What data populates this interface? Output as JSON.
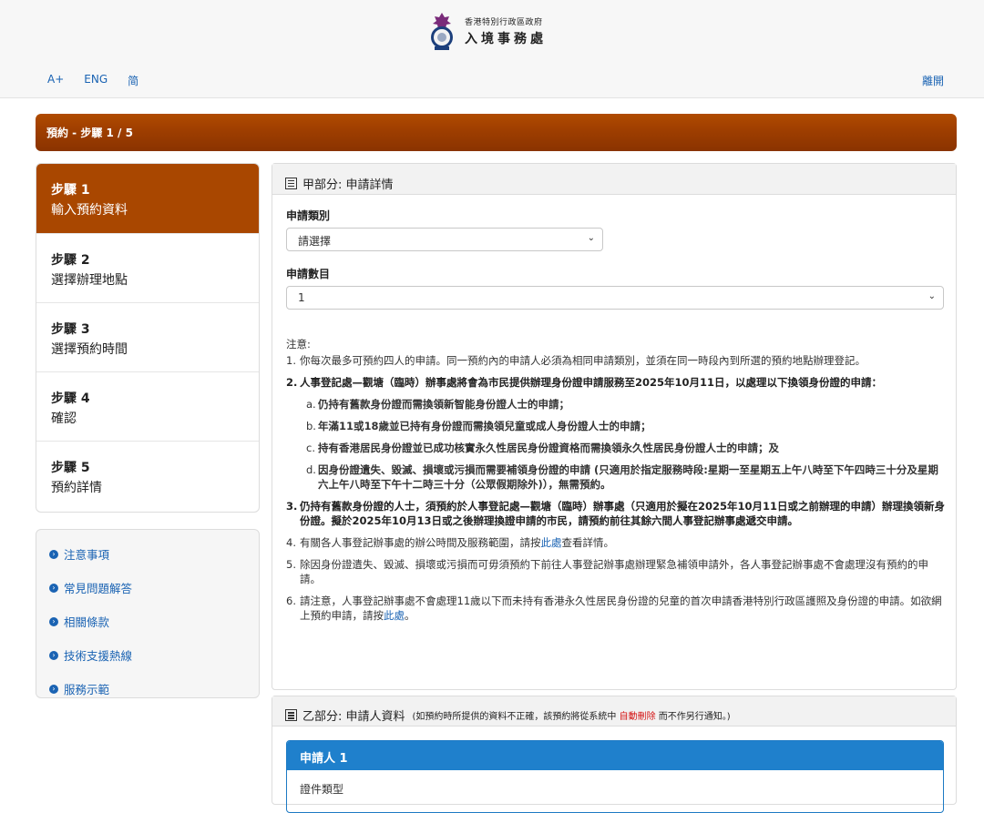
{
  "header": {
    "dept_line1": "香港特別行政區政府",
    "dept_line2": "入境事務處",
    "nav": [
      "A+",
      "ENG",
      "简"
    ],
    "exit_label": "離開"
  },
  "stepbar": {
    "label": "預約 - 步驟 1 / 5"
  },
  "steps": [
    {
      "num": "步驟 1",
      "title": "輸入預約資料",
      "active": true
    },
    {
      "num": "步驟 2",
      "title": "選擇辦理地點",
      "active": false
    },
    {
      "num": "步驟 3",
      "title": "選擇預約時間",
      "active": false
    },
    {
      "num": "步驟 4",
      "title": "確認",
      "active": false
    },
    {
      "num": "步驟 5",
      "title": "預約詳情",
      "active": false
    }
  ],
  "side_links": [
    "注意事項",
    "常見問題解答",
    "相關條款",
    "技術支援熱線",
    "服務示範"
  ],
  "panelA": {
    "title": "甲部分: 申請詳情",
    "category_label": "申請類別",
    "category_value": "請選擇",
    "count_label": "申請數目",
    "count_value": "1",
    "notes_header": "注意:",
    "note1": "你每次最多可預約四人的申請。同一預約內的申請人必須為相同申請類別，並須在同一時段內到所選的預約地點辦理登記。",
    "note2": "人事登記處—觀塘（臨時）辦事處將會為市民提供辦理身份證申請服務至2025年10月11日，以處理以下換領身份證的申請：",
    "note2a": "仍持有舊款身份證而需換領新智能身份證人士的申請；",
    "note2b": "年滿11或18歲並已持有身份證而需換領兒童或成人身份證人士的申請；",
    "note2c": "持有香港居民身份證並已成功核實永久性居民身份證資格而需換領永久性居民身份證人士的申請；及",
    "note2d": "因身份證遺失、毀滅、損壞或污損而需要補領身份證的申請 (只適用於指定服務時段:星期一至星期五上午八時至下午四時三十分及星期六上午八時至下午十二時三十分（公眾假期除外)），無需預約。",
    "note3": "仍持有舊款身份證的人士，須預約於人事登記處—觀塘（臨時）辦事處（只適用於擬在2025年10月11日或之前辦理的申請）辦理換領新身份證。擬於2025年10月13日或之後辦理換證申請的市民，請預約前往其餘六間人事登記辦事處遞交申請。",
    "note4_pre": "有關各人事登記辦事處的辦公時間及服務範圍，請按",
    "note4_link": "此處",
    "note4_post": "查看詳情。",
    "note5": "除因身份證遺失、毀滅、損壞或污損而可毋須預約下前往人事登記辦事處辦理緊急補領申請外，各人事登記辦事處不會處理沒有預約的申請。",
    "note6_pre": "請注意，人事登記辦事處不會處理11歲以下而未持有香港永久性居民身份證的兒童的首次申請香港特別行政區護照及身份證的申請。如欲網上預約申請，請按",
    "note6_link": "此處",
    "note6_post": "。"
  },
  "panelB": {
    "title": "乙部分: 申請人資料",
    "note_pre": "(如預約時所提供的資料不正確，該預約將從系統中",
    "note_red": "自動刪除",
    "note_post": "而不作另行通知。)",
    "applicant_title": "申請人 1",
    "applicant_field": "證件類型"
  },
  "colors": {
    "brand_orange": "#a94700",
    "link_blue": "#1a63b3",
    "applicant_blue": "#1f80cc",
    "alert_red": "#d41414"
  }
}
